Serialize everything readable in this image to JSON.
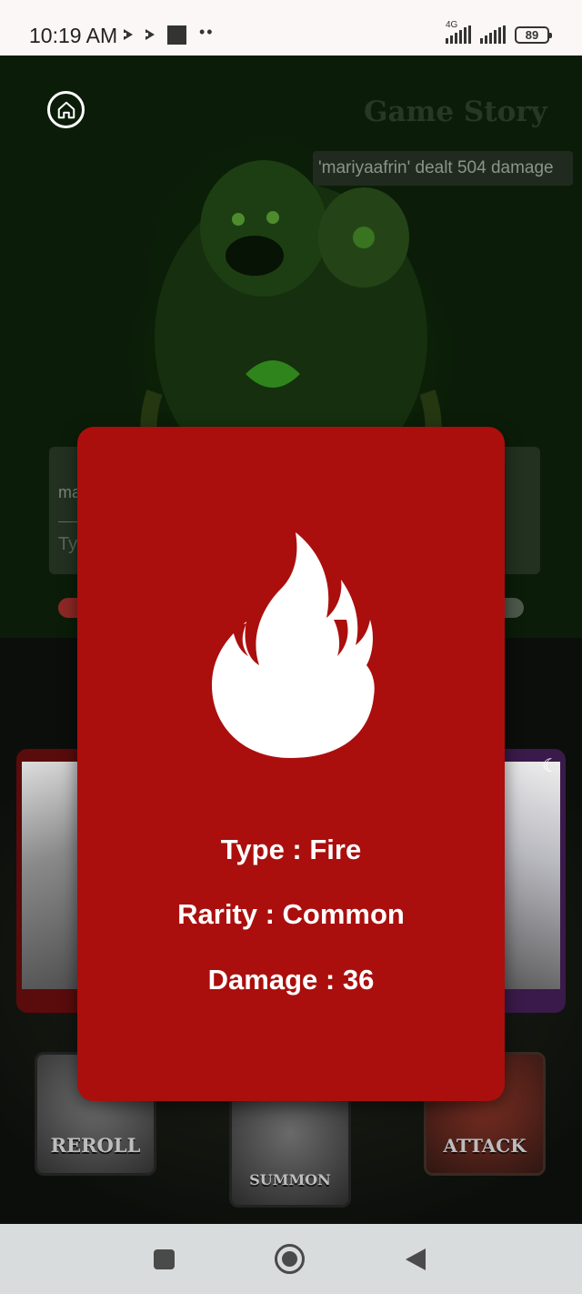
{
  "status_bar": {
    "time": "10:19 AM",
    "network": "4G",
    "battery": "89",
    "icons": [
      "play-icon",
      "play-icon",
      "stop-square-icon",
      "more-dots-icon",
      "signal-icon",
      "signal-icon",
      "battery-icon"
    ]
  },
  "game": {
    "title": "Game Story",
    "home_icon": "home-icon",
    "log_message": "'mariyaafrin' dealt 504 damage",
    "chat_preview": "ma",
    "chat_input_placeholder": "Ty"
  },
  "actions": {
    "reroll_label": "REROLL",
    "summon_label": "SUMMON",
    "attack_label": "ATTACK"
  },
  "card_modal": {
    "icon": "fire-icon",
    "type_text": "Type : Fire",
    "rarity_text": "Rarity : Common",
    "damage_text": "Damage : 36",
    "color": "#aa0f0d"
  },
  "nav_bar": {
    "icons": [
      "recent-apps-icon",
      "home-circle-icon",
      "back-icon"
    ]
  }
}
